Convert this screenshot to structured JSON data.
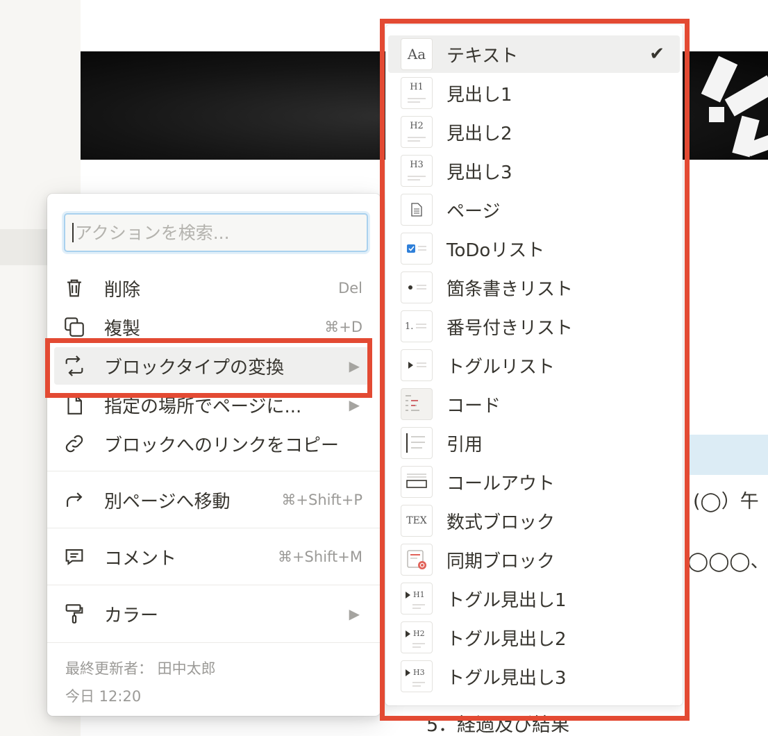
{
  "background": {
    "cover_image": "abstract-black-white-image",
    "page_text_right_1": "(◯）午",
    "page_text_right_2": "◯◯◯、",
    "page_text_bottom": "5．経過及び結果"
  },
  "action_menu": {
    "search": {
      "placeholder": "アクションを検索..."
    },
    "items": [
      {
        "label": "削除",
        "shortcut": "Del",
        "icon": "trash-icon"
      },
      {
        "label": "複製",
        "shortcut": "⌘+D",
        "icon": "duplicate-icon"
      },
      {
        "label": "ブロックタイプの変換",
        "arrow": "▶",
        "icon": "turn-into-icon"
      },
      {
        "label": "指定の場所でページに...",
        "arrow": "▶",
        "icon": "page-icon"
      },
      {
        "label": "ブロックへのリンクをコピー",
        "icon": "link-icon"
      },
      {
        "label": "別ページへ移動",
        "shortcut": "⌘+Shift+P",
        "icon": "move-to-icon"
      },
      {
        "label": "コメント",
        "shortcut": "⌘+Shift+M",
        "icon": "comment-icon"
      },
      {
        "label": "カラー",
        "arrow": "▶",
        "icon": "paint-roller-icon"
      }
    ],
    "footer": {
      "last_edited_by": "最終更新者： 田中太郎",
      "last_edited_time": "今日 12:20"
    }
  },
  "block_types": {
    "check_mark": "✔",
    "items": [
      {
        "label": "テキスト",
        "icon_text": "Aa",
        "selected": true
      },
      {
        "label": "見出し1",
        "icon_text": "H1"
      },
      {
        "label": "見出し2",
        "icon_text": "H2"
      },
      {
        "label": "見出し3",
        "icon_text": "H3"
      },
      {
        "label": "ページ",
        "icon_text": ""
      },
      {
        "label": "ToDoリスト",
        "icon_text": ""
      },
      {
        "label": "箇条書きリスト",
        "icon_text": ""
      },
      {
        "label": "番号付きリスト",
        "icon_text": "1."
      },
      {
        "label": "トグルリスト",
        "icon_text": ""
      },
      {
        "label": "コード",
        "icon_text": ""
      },
      {
        "label": "引用",
        "icon_text": ""
      },
      {
        "label": "コールアウト",
        "icon_text": ""
      },
      {
        "label": "数式ブロック",
        "icon_text": "TEX"
      },
      {
        "label": "同期ブロック",
        "icon_text": ""
      },
      {
        "label": "トグル見出し1",
        "icon_text": "H1"
      },
      {
        "label": "トグル見出し2",
        "icon_text": "H2"
      },
      {
        "label": "トグル見出し3",
        "icon_text": "H3"
      }
    ]
  },
  "colors": {
    "annotation": "#e34a33",
    "hover_bg": "#efefee",
    "text": "#37352f",
    "muted": "#9b9a97"
  }
}
